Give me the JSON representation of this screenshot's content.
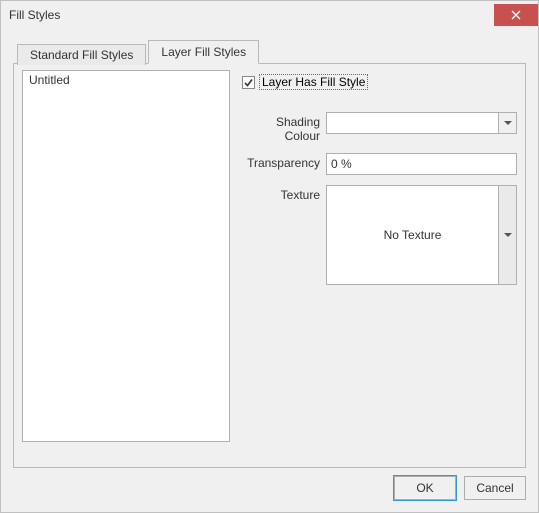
{
  "window": {
    "title": "Fill Styles"
  },
  "tabs": {
    "standard": "Standard Fill Styles",
    "layer": "Layer Fill Styles"
  },
  "list": {
    "items": [
      "Untitled"
    ]
  },
  "form": {
    "hasFillStyle": {
      "label": "Layer Has Fill Style",
      "checked": true
    },
    "shadingColour": {
      "label": "Shading Colour",
      "value": ""
    },
    "transparency": {
      "label": "Transparency",
      "value": "0 %"
    },
    "texture": {
      "label": "Texture",
      "previewText": "No Texture"
    }
  },
  "buttons": {
    "ok": "OK",
    "cancel": "Cancel"
  }
}
